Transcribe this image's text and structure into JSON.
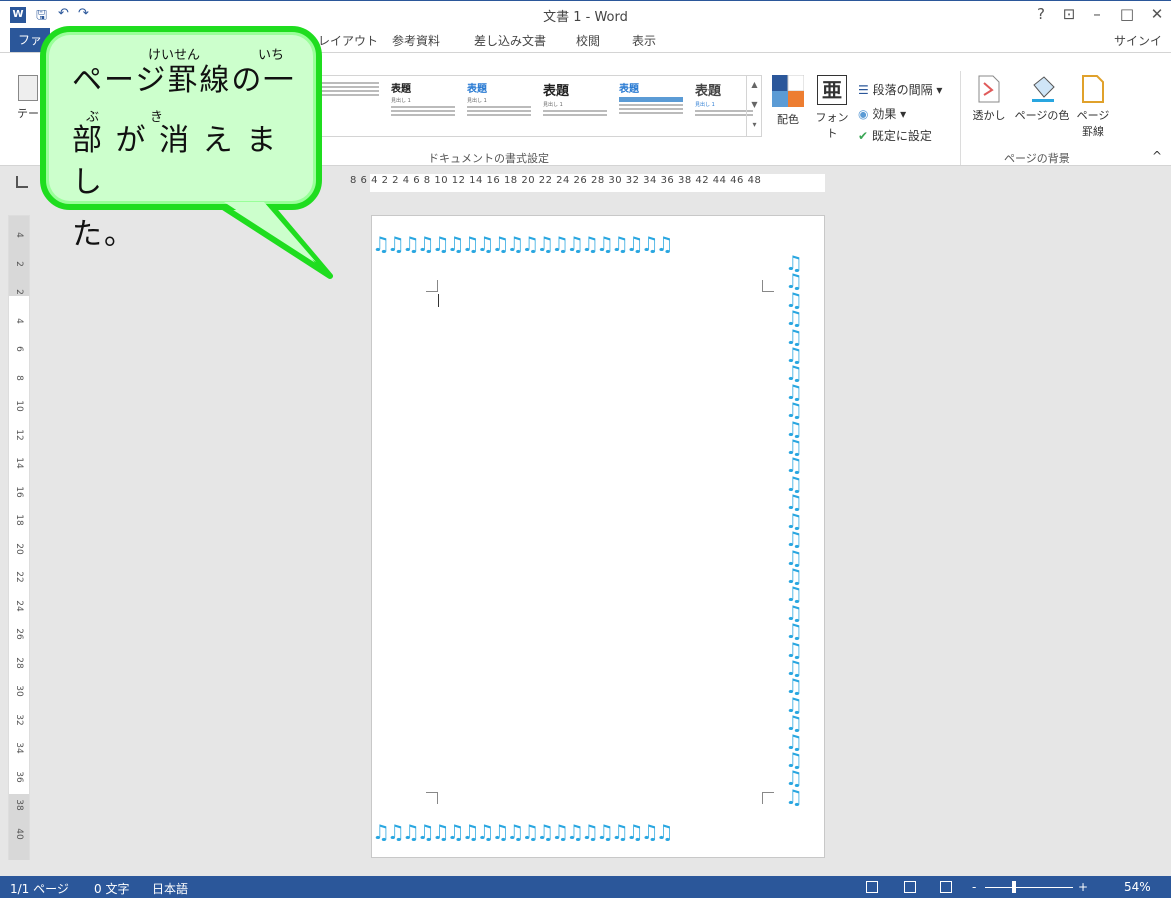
{
  "window": {
    "title": "文書 1 - Word",
    "help": "?",
    "restore_ribbon": "⊡",
    "minimize": "–",
    "maximize": "□",
    "close": "✕",
    "signin": "サインイン"
  },
  "qat": {
    "save": "🖫",
    "undo": "↶",
    "redo": "↷",
    "more": "⁼"
  },
  "tabs": {
    "file": "ファ",
    "layout": "レイアウト",
    "references": "参考資料",
    "mailings": "差し込み文書",
    "review": "校閲",
    "view": "表示"
  },
  "ribbon": {
    "themes_label": "テー",
    "styles": [
      {
        "head": "",
        "sub": "",
        "body": ""
      },
      {
        "head": "表題",
        "sub": "見出し 1"
      },
      {
        "head": "表題",
        "sub": "見出し 1"
      },
      {
        "head": "表題",
        "sub": "見出し 1"
      },
      {
        "head": "表題",
        "sub": ""
      },
      {
        "head": "表題",
        "sub": "見出し 1"
      }
    ],
    "colors": "配色",
    "fonts": "フォント",
    "fonts_glyph": "亜",
    "paragraph_spacing": "段落の間隔",
    "effects": "効果",
    "set_default": "既定に設定",
    "doc_format_group": "ドキュメントの書式設定",
    "watermark": "透かし",
    "page_color": "ページの色",
    "page_borders_line1": "ページ",
    "page_borders_line2": "罫線",
    "page_bg_group": "ページの背景",
    "collapse": "^"
  },
  "ruler": {
    "numbers": "8  6  4  2      2  4  6  8  10  12  14  16  18  20  22  24  26  28  30  32  34  36  38      42  44  46  48"
  },
  "vruler": [
    "4",
    "2",
    "2",
    "4",
    "6",
    "8",
    "10",
    "12",
    "14",
    "16",
    "18",
    "20",
    "22",
    "24",
    "26",
    "28",
    "30",
    "32",
    "34",
    "36",
    "38",
    "40"
  ],
  "callout": {
    "ruby1": "けいせん",
    "ruby2": "いち",
    "ruby3": "ぶ",
    "ruby4": "き",
    "line1": "ページ罫線の一",
    "line2": "部 が 消 え ま し",
    "line3": "た。"
  },
  "border_glyph_row": "♫♫♫♫♫♫♫♫♫♫♫♫♫♫♫♫♫♫♫♫",
  "border_glyph_col": "♫",
  "status": {
    "page": "1/1 ページ",
    "words": "0 文字",
    "lang": "日本語",
    "zoom_minus": "-",
    "zoom_plus": "+",
    "zoom": "54%"
  },
  "colors": {
    "accent": "#2b579a",
    "note": "#29a6e0",
    "callout_border": "#1fdd1f",
    "callout_fill": "#ccffcc"
  }
}
